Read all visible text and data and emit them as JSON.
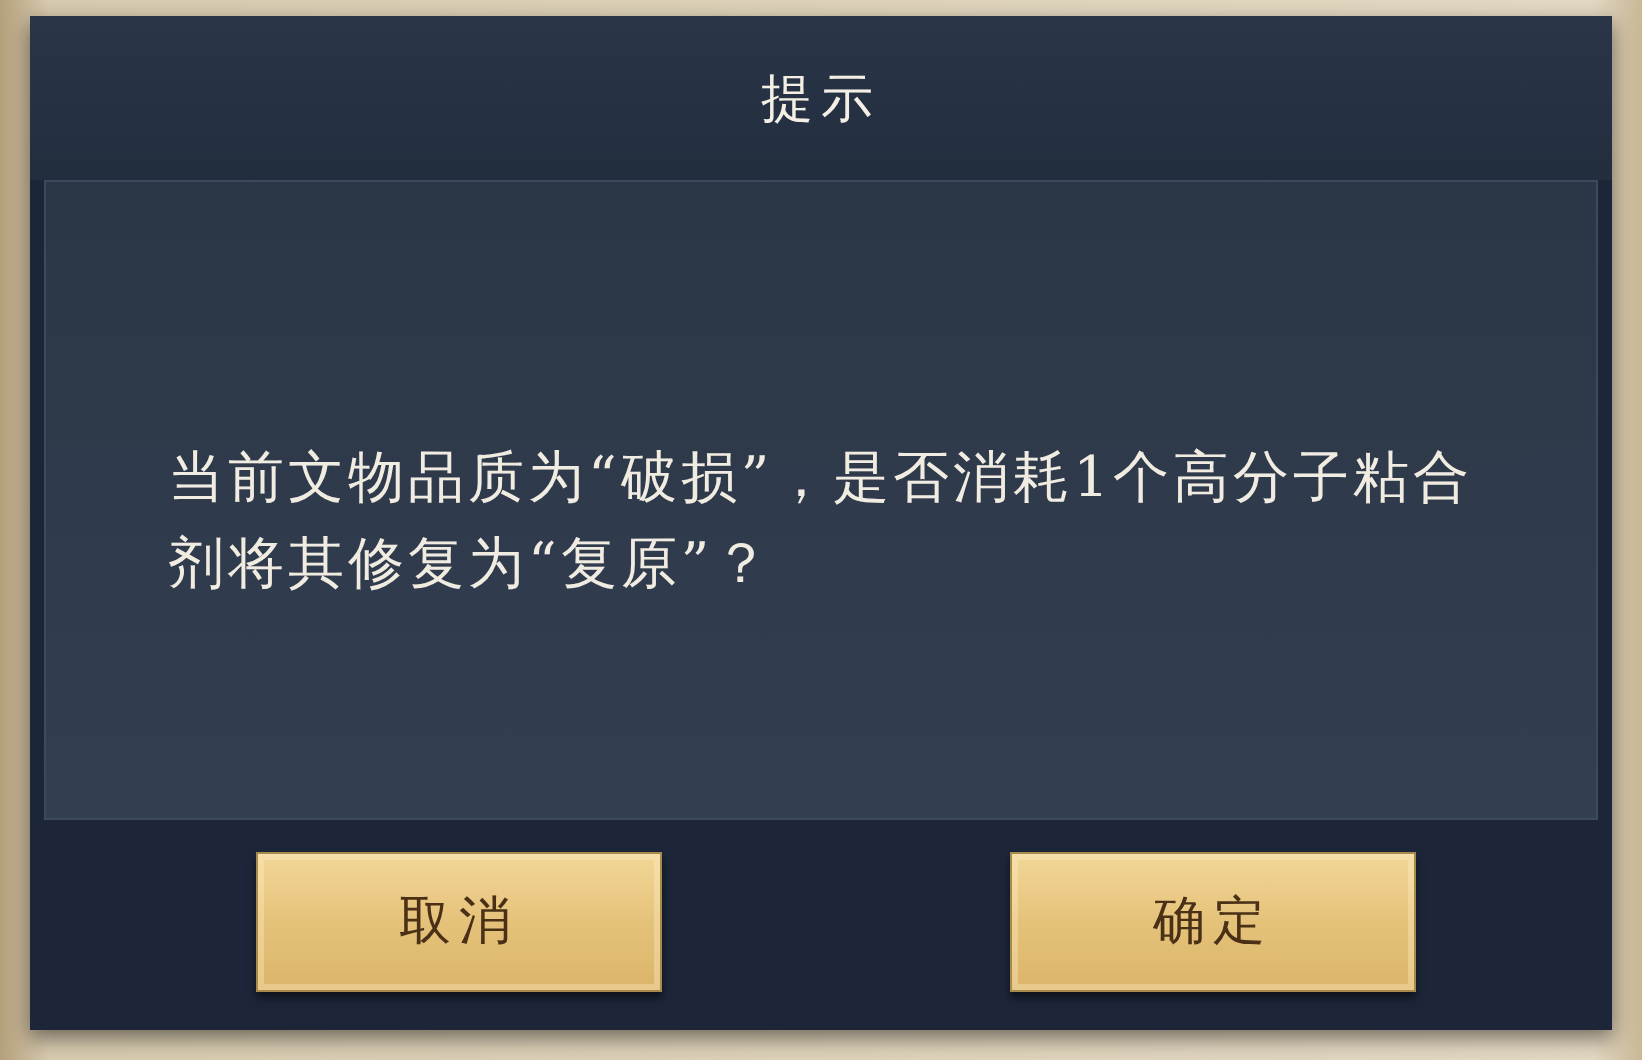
{
  "dialog": {
    "title": "提示",
    "message": "当前文物品质为“破损”，是否消耗1个高分子粘合剂将其修复为“复原”？",
    "buttons": [
      {
        "label": "取消"
      },
      {
        "label": "确定"
      }
    ]
  }
}
